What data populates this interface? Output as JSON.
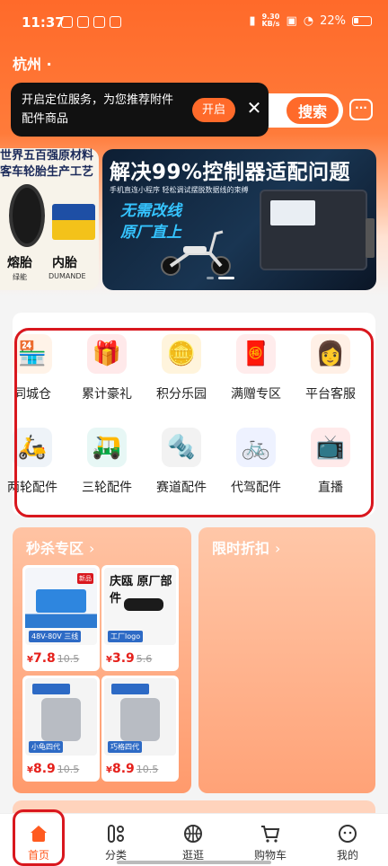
{
  "status_bar": {
    "time": "11:37",
    "speed_value": "9.30",
    "speed_unit": "KB/s",
    "battery": "22%"
  },
  "location": {
    "city": "杭州"
  },
  "location_tip": {
    "text": "开启定位服务，为您推荐附件配件商品",
    "open_label": "开启",
    "close_icon": "close-icon"
  },
  "search": {
    "button_label": "搜索",
    "message_icon": "message-icon"
  },
  "banner": {
    "left": {
      "title_line1": "世界五百强原材料",
      "title_line2": "客车轮胎生产工艺",
      "caption_left": "熔胎",
      "caption_right": "内胎",
      "brands": [
        "绿能",
        "DUMANDE"
      ]
    },
    "main": {
      "headline": "解决99%控制器适配问题",
      "subline": "手机直连小程序 轻松调试摆脱数据线的束缚",
      "slogan_line1": "无需改线",
      "slogan_line2": "原厂直上"
    },
    "dots": 2,
    "active_dot": 2
  },
  "categories": [
    {
      "label": "同城仓",
      "icon": "warehouse-icon",
      "glyph": "🏪"
    },
    {
      "label": "累计豪礼",
      "icon": "gift-icon",
      "glyph": "🎁"
    },
    {
      "label": "积分乐园",
      "icon": "coin-box-icon",
      "glyph": "🪙"
    },
    {
      "label": "满赠专区",
      "icon": "red-envelope-icon",
      "glyph": "🧧"
    },
    {
      "label": "平台客服",
      "icon": "customer-service-icon",
      "glyph": "👩"
    },
    {
      "label": "两轮配件",
      "icon": "scooter-icon",
      "glyph": "🛵"
    },
    {
      "label": "三轮配件",
      "icon": "tricycle-icon",
      "glyph": "🛺"
    },
    {
      "label": "赛道配件",
      "icon": "exhaust-icon",
      "glyph": "🔩"
    },
    {
      "label": "代驾配件",
      "icon": "ebike-icon",
      "glyph": "🚲"
    },
    {
      "label": "直播",
      "icon": "live-tv-icon",
      "glyph": "📺"
    }
  ],
  "promo": {
    "flash_sale_title": "秒杀专区",
    "time_discount_title": "限时折扣",
    "arrow": "›",
    "products": [
      {
        "price": "7.8",
        "old_price": "10.5",
        "currency": "¥",
        "image_icon": "battery-pack-icon",
        "img_label": "48V-80V 三线",
        "img_tag": "新品"
      },
      {
        "price": "3.9",
        "old_price": "5.6",
        "currency": "¥",
        "image_icon": "throttle-grip-icon",
        "img_label": "工厂logo",
        "img_title": "庆瓯 原厂部件"
      },
      {
        "price": "8.9",
        "old_price": "10.5",
        "currency": "¥",
        "image_icon": "hub-motor-icon",
        "img_label": "小龟四代"
      },
      {
        "price": "8.9",
        "old_price": "10.5",
        "currency": "¥",
        "image_icon": "hub-motor-icon",
        "img_label": "巧格四代"
      }
    ]
  },
  "bottom_nav": [
    {
      "label": "首页",
      "icon": "home-icon",
      "active": true
    },
    {
      "label": "分类",
      "icon": "category-icon",
      "active": false
    },
    {
      "label": "逛逛",
      "icon": "basketball-icon",
      "active": false
    },
    {
      "label": "购物车",
      "icon": "cart-icon",
      "active": false
    },
    {
      "label": "我的",
      "icon": "profile-icon",
      "active": false
    }
  ],
  "colors": {
    "brand_orange": "#ff6a2a",
    "highlight_red": "#d9171e",
    "price_red": "#e5201b"
  }
}
